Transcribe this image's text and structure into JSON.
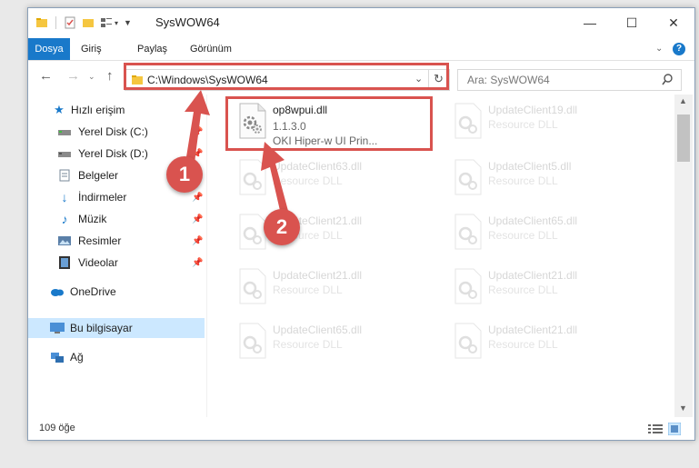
{
  "window": {
    "title": "SysWOW64",
    "controls": {
      "minimize": "—",
      "maximize": "☐",
      "close": "✕"
    }
  },
  "ribbon": {
    "tabs": [
      "Dosya",
      "Giriş",
      "Paylaş",
      "Görünüm"
    ],
    "help": "?"
  },
  "navigation": {
    "address": "C:\\Windows\\SysWOW64",
    "search_placeholder": "Ara: SysWOW64"
  },
  "sidebar": {
    "quick_access": "Hızlı erişim",
    "items": [
      {
        "label": "Yerel Disk (C:)",
        "icon": "drive-icon"
      },
      {
        "label": "Yerel Disk (D:)",
        "icon": "drive-icon"
      },
      {
        "label": "Belgeler",
        "icon": "documents-icon"
      },
      {
        "label": "İndirmeler",
        "icon": "downloads-icon"
      },
      {
        "label": "Müzik",
        "icon": "music-icon"
      },
      {
        "label": "Resimler",
        "icon": "pictures-icon"
      },
      {
        "label": "Videolar",
        "icon": "videos-icon"
      }
    ],
    "onedrive": "OneDrive",
    "this_pc": "Bu bilgisayar",
    "network": "Ağ"
  },
  "files": {
    "highlighted": {
      "name": "op8wpui.dll",
      "version": "1.1.3.0",
      "description": "OKI Hiper-w UI Prin..."
    },
    "faded": [
      {
        "name": "UpdateClient19.dll",
        "type": "Resource DLL"
      },
      {
        "name": "UpdateClient63.dll",
        "type": "Resource DLL"
      },
      {
        "name": "UpdateClient5.dll",
        "type": "Resource DLL"
      },
      {
        "name": "UpdateClient21.dll",
        "type": "Resource DLL"
      },
      {
        "name": "UpdateClient65.dll",
        "type": "Resource DLL"
      },
      {
        "name": "UpdateClient21.dll",
        "type": "Resource DLL"
      },
      {
        "name": "UpdateClient21.dll",
        "type": "Resource DLL"
      },
      {
        "name": "UpdateClient65.dll",
        "type": "Resource DLL"
      },
      {
        "name": "UpdateClient21.dll",
        "type": "Resource DLL"
      }
    ]
  },
  "status": {
    "count": "109 öğe"
  },
  "annotations": {
    "step1": "1",
    "step2": "2",
    "color": "#d9534f"
  }
}
